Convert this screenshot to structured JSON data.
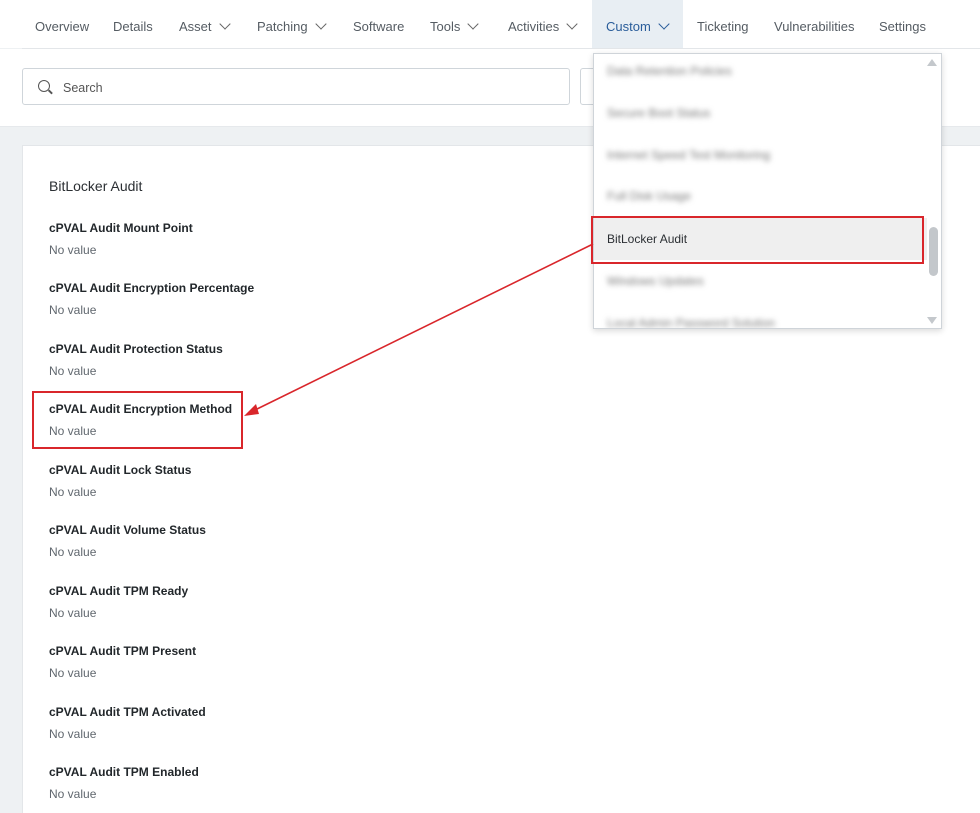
{
  "nav": {
    "tabs": [
      {
        "label": "Overview"
      },
      {
        "label": "Details"
      },
      {
        "label": "Asset"
      },
      {
        "label": "Patching"
      },
      {
        "label": "Software"
      },
      {
        "label": "Tools"
      },
      {
        "label": "Activities"
      },
      {
        "label": "Custom"
      },
      {
        "label": "Ticketing"
      },
      {
        "label": "Vulnerabilities"
      },
      {
        "label": "Settings"
      }
    ]
  },
  "search": {
    "placeholder": "Search"
  },
  "custom_dropdown": {
    "items": [
      {
        "label": "Data Retention Policies"
      },
      {
        "label": "Secure Boot Status"
      },
      {
        "label": "Internet Speed Test Monitoring"
      },
      {
        "label": "Full Disk Usage"
      },
      {
        "label": "BitLocker Audit"
      },
      {
        "label": "Windows Updates"
      },
      {
        "label": "Local Admin Password Solution"
      }
    ],
    "selected": "BitLocker Audit"
  },
  "panel": {
    "title": "BitLocker Audit",
    "fields": [
      {
        "label": "cPVAL Audit Mount Point",
        "value": "No value"
      },
      {
        "label": "cPVAL Audit Encryption Percentage",
        "value": "No value"
      },
      {
        "label": "cPVAL Audit Protection Status",
        "value": "No value"
      },
      {
        "label": "cPVAL Audit Encryption Method",
        "value": "No value"
      },
      {
        "label": "cPVAL Audit Lock Status",
        "value": "No value"
      },
      {
        "label": "cPVAL Audit Volume Status",
        "value": "No value"
      },
      {
        "label": "cPVAL Audit TPM Ready",
        "value": "No value"
      },
      {
        "label": "cPVAL Audit TPM Present",
        "value": "No value"
      },
      {
        "label": "cPVAL Audit TPM Activated",
        "value": "No value"
      },
      {
        "label": "cPVAL Audit TPM Enabled",
        "value": "No value"
      }
    ]
  },
  "annotation": {
    "color": "#d9262b"
  }
}
